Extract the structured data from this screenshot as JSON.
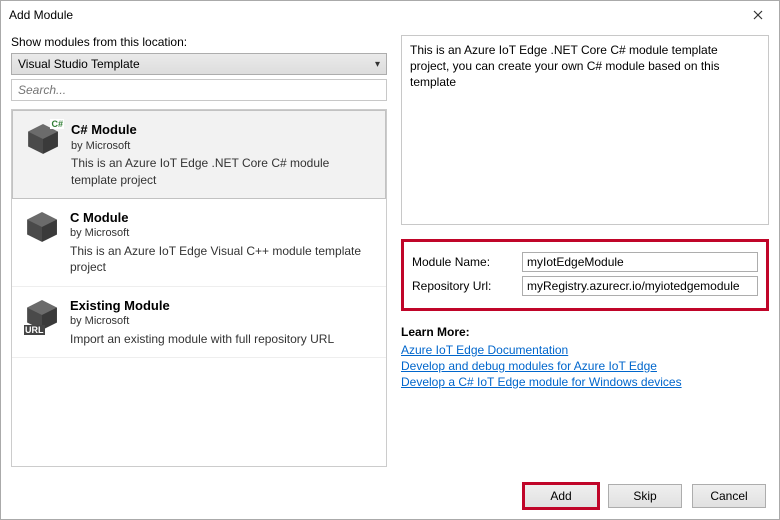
{
  "window": {
    "title": "Add Module"
  },
  "left": {
    "location_label": "Show modules from this location:",
    "location_value": "Visual Studio Template",
    "search_placeholder": "Search...",
    "modules": [
      {
        "title": "C# Module",
        "by": "by Microsoft",
        "desc": "This is an Azure IoT Edge .NET Core C# module template project",
        "badge": "C#"
      },
      {
        "title": "C Module",
        "by": "by Microsoft",
        "desc": "This is an Azure IoT Edge Visual C++ module template project",
        "badge": ""
      },
      {
        "title": "Existing Module",
        "by": "by Microsoft",
        "desc": "Import an existing module with full repository URL",
        "badge": "URL"
      }
    ]
  },
  "right": {
    "description": "This is an Azure IoT Edge .NET Core C# module template project, you can create your own C# module based on this template",
    "module_name_label": "Module Name:",
    "module_name_value": "myIotEdgeModule",
    "repo_url_label": "Repository Url:",
    "repo_url_value": "myRegistry.azurecr.io/myiotedgemodule",
    "learn_title": "Learn More:",
    "links": [
      "Azure IoT Edge Documentation",
      "Develop and debug modules for Azure IoT Edge ",
      "Develop a C# IoT Edge module for Windows devices "
    ]
  },
  "footer": {
    "add": "Add",
    "skip": "Skip",
    "cancel": "Cancel"
  }
}
